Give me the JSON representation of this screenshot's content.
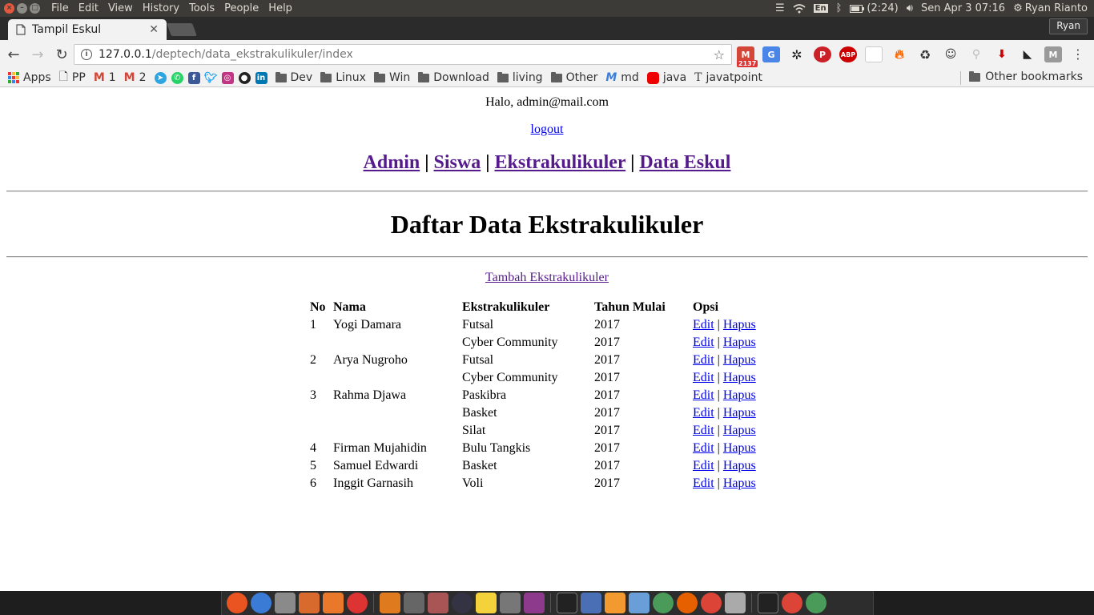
{
  "system_bar": {
    "menus": [
      "File",
      "Edit",
      "View",
      "History",
      "Tools",
      "People",
      "Help"
    ],
    "keyboard_layout": "En",
    "battery": "(2:24)",
    "datetime": "Sen Apr 3 07:16",
    "user": "Ryan Rianto"
  },
  "browser": {
    "tab_title": "Tampil Eskul",
    "profile_name": "Ryan",
    "url_host": "127.0.0.1",
    "url_path": "/deptech/data_ekstrakulikuler/index",
    "gmail_badge": "2137"
  },
  "bookmarks": {
    "items": [
      {
        "label": "Apps",
        "icon": "apps-grid-icon"
      },
      {
        "label": "PP",
        "icon": "page-icon"
      },
      {
        "label": "1",
        "icon": "gmail-icon"
      },
      {
        "label": "2",
        "icon": "gmail-icon"
      },
      {
        "label": "",
        "icon": "telegram-icon"
      },
      {
        "label": "",
        "icon": "whatsapp-icon"
      },
      {
        "label": "",
        "icon": "facebook-icon"
      },
      {
        "label": "",
        "icon": "twitter-icon"
      },
      {
        "label": "",
        "icon": "instagram-icon"
      },
      {
        "label": "",
        "icon": "github-icon"
      },
      {
        "label": "",
        "icon": "linkedin-icon"
      },
      {
        "label": "Dev",
        "icon": "folder-icon"
      },
      {
        "label": "Linux",
        "icon": "folder-icon"
      },
      {
        "label": "Win",
        "icon": "folder-icon"
      },
      {
        "label": "Download",
        "icon": "folder-icon"
      },
      {
        "label": "living",
        "icon": "folder-icon"
      },
      {
        "label": "Other",
        "icon": "folder-icon"
      },
      {
        "label": "md",
        "icon": "markdown-icon"
      },
      {
        "label": "java",
        "icon": "java-icon"
      },
      {
        "label": "javatpoint",
        "icon": "javatpoint-icon"
      }
    ],
    "other_bookmarks": "Other bookmarks"
  },
  "page": {
    "greeting": "Halo, admin@mail.com",
    "logout_label": "logout",
    "nav": {
      "admin": "Admin",
      "siswa": "Siswa",
      "ekstrakulikuler": "Ekstrakulikuler",
      "data_eskul": "Data Eskul",
      "separator": "|"
    },
    "heading": "Daftar Data Ekstrakulikuler",
    "add_link": "Tambah Ekstrakulikuler",
    "table": {
      "headers": [
        "No",
        "Nama",
        "Ekstrakulikuler",
        "Tahun Mulai",
        "Opsi"
      ],
      "edit_label": "Edit",
      "delete_label": "Hapus",
      "option_separator": "|",
      "rows": [
        {
          "no": "1",
          "nama": "Yogi Damara",
          "eskul": "Futsal",
          "tahun": "2017"
        },
        {
          "no": "",
          "nama": "",
          "eskul": "Cyber Community",
          "tahun": "2017"
        },
        {
          "no": "2",
          "nama": "Arya Nugroho",
          "eskul": "Futsal",
          "tahun": "2017"
        },
        {
          "no": "",
          "nama": "",
          "eskul": "Cyber Community",
          "tahun": "2017"
        },
        {
          "no": "3",
          "nama": "Rahma Djawa",
          "eskul": "Paskibra",
          "tahun": "2017"
        },
        {
          "no": "",
          "nama": "",
          "eskul": "Basket",
          "tahun": "2017"
        },
        {
          "no": "",
          "nama": "",
          "eskul": "Silat",
          "tahun": "2017"
        },
        {
          "no": "4",
          "nama": "Firman Mujahidin",
          "eskul": "Bulu Tangkis",
          "tahun": "2017"
        },
        {
          "no": "5",
          "nama": "Samuel Edwardi",
          "eskul": "Basket",
          "tahun": "2017"
        },
        {
          "no": "6",
          "nama": "Inggit Garnasih",
          "eskul": "Voli",
          "tahun": "2017"
        }
      ]
    }
  },
  "colors": {
    "link": "#0000ee",
    "visited_link": "#551a8b",
    "system_panel": "#3c3b37"
  }
}
